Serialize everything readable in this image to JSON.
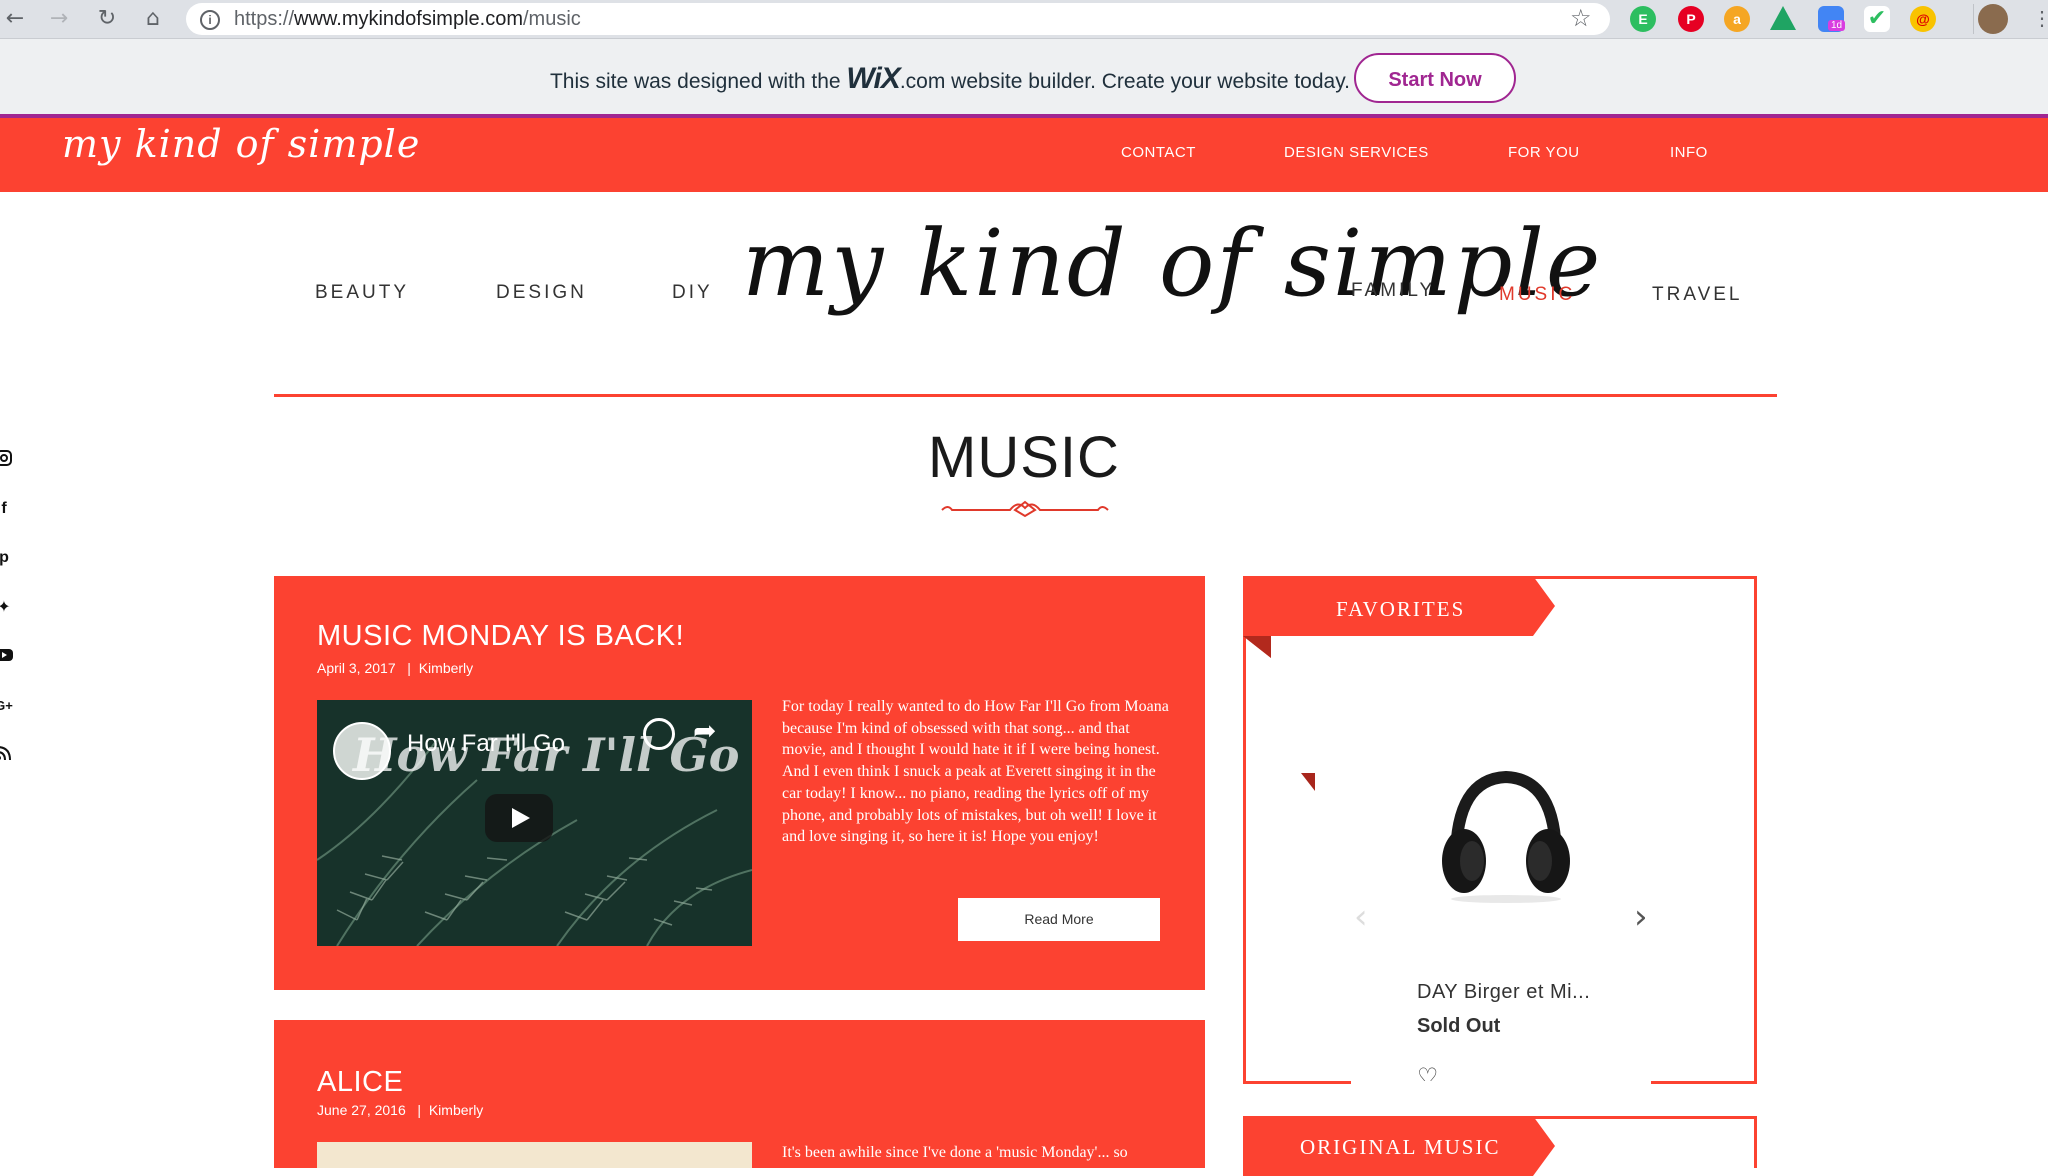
{
  "browser": {
    "url_prefix": "https://",
    "url_domain": "www.mykindofsimple.com",
    "url_path": "/music",
    "extension_badge": "1d"
  },
  "wix_banner": {
    "text_before": "This site was designed with the ",
    "brand": "WiX",
    "text_after": ".com website builder. Create your website today.",
    "button": "Start Now"
  },
  "topbar": {
    "logo": "my kind of simple",
    "nav": [
      "CONTACT",
      "DESIGN SERVICES",
      "FOR YOU",
      "INFO"
    ]
  },
  "main_nav": {
    "left": [
      "BEAUTY",
      "DESIGN",
      "DIY"
    ],
    "logo": "my kind of simple",
    "right": [
      "FAMILY",
      "MUSIC",
      "TRAVEL"
    ],
    "active": "MUSIC"
  },
  "page_title": "MUSIC",
  "social_icons": [
    "instagram-icon",
    "facebook-icon",
    "pinterest-icon",
    "twitter-icon",
    "youtube-icon",
    "google-plus-icon",
    "rss-icon"
  ],
  "posts": [
    {
      "title": "MUSIC MONDAY IS BACK!",
      "date": "April 3, 2017",
      "author": "Kimberly",
      "video_title": "How Far I'll Go",
      "video_overlay": "How Far I'll Go",
      "body": "For today I really wanted to do How Far I'll Go from Moana because I'm kind of obsessed with that song... and that movie, and I thought I would hate it if I were being honest. And I even think I snuck a peak at Everett singing it in the car today! I know... no piano, reading the lyrics off of my phone, and probably lots of mistakes, but oh well! I love it and love singing it, so here it is! Hope you enjoy!",
      "read_more": "Read More"
    },
    {
      "title": "ALICE",
      "date": "June 27, 2016",
      "author": "Kimberly",
      "body": "It's been awhile since I've done a 'music Monday'... so"
    }
  ],
  "sidebar": {
    "favorites_label": "FAVORITES",
    "product_name": "DAY Birger et Mi...",
    "product_status": "Sold Out",
    "original_music_label": "ORIGINAL MUSIC"
  },
  "colors": {
    "brand_red": "#fc4231",
    "wix_purple": "#a02691"
  }
}
